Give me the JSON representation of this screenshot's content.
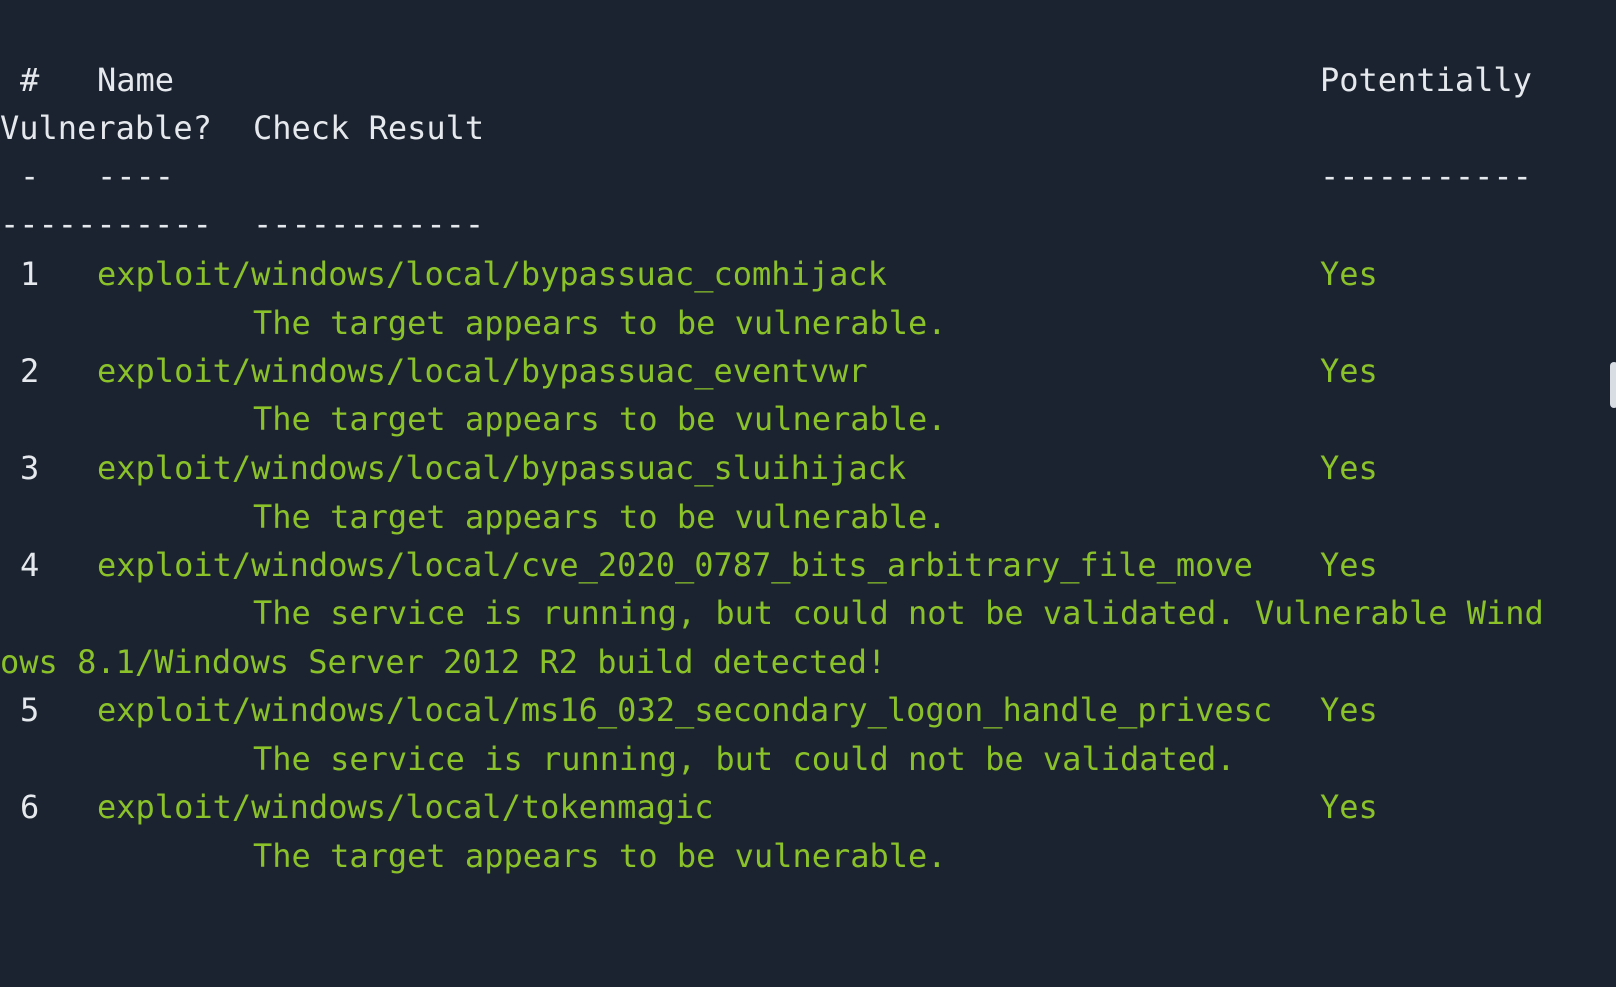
{
  "terminal": {
    "header": {
      "num_label": "#",
      "name_label": "Name",
      "potentially_label": "Potentially",
      "vulnerable_label": "Vulnerable?",
      "check_result_label": "Check Result",
      "num_underline": "-",
      "name_underline": "----",
      "potentially_underline": "-----------",
      "vulnerable_underline": "-----------",
      "check_result_underline": "------------"
    },
    "rows": [
      {
        "num": "1",
        "name": "exploit/windows/local/bypassuac_comhijack",
        "vulnerable": "Yes",
        "result_lines": [
          "The target appears to be vulnerable."
        ]
      },
      {
        "num": "2",
        "name": "exploit/windows/local/bypassuac_eventvwr",
        "vulnerable": "Yes",
        "result_lines": [
          "The target appears to be vulnerable."
        ]
      },
      {
        "num": "3",
        "name": "exploit/windows/local/bypassuac_sluihijack",
        "vulnerable": "Yes",
        "result_lines": [
          "The target appears to be vulnerable."
        ]
      },
      {
        "num": "4",
        "name": "exploit/windows/local/cve_2020_0787_bits_arbitrary_file_move",
        "vulnerable": "Yes",
        "result_lines": [
          "The service is running, but could not be validated. Vulnerable Wind",
          "ows 8.1/Windows Server 2012 R2 build detected!"
        ]
      },
      {
        "num": "5",
        "name": "exploit/windows/local/ms16_032_secondary_logon_handle_privesc",
        "vulnerable": "Yes",
        "result_lines": [
          "The service is running, but could not be validated."
        ]
      },
      {
        "num": "6",
        "name": "exploit/windows/local/tokenmagic",
        "vulnerable": "Yes",
        "result_lines": [
          "The target appears to be vulnerable."
        ]
      }
    ]
  },
  "colors": {
    "background": "#1b2331",
    "header_text": "#e5e8ec",
    "result_text": "#8bc22a"
  }
}
